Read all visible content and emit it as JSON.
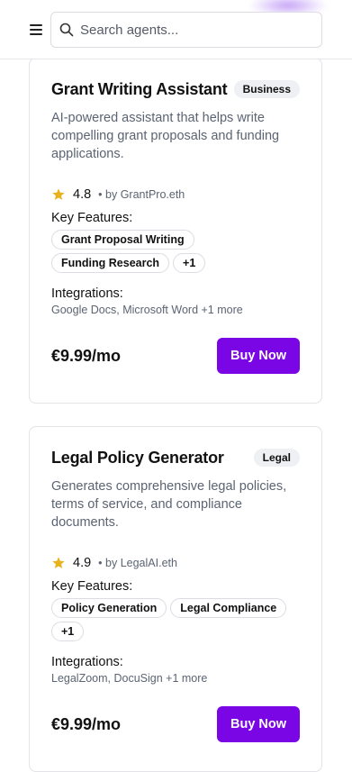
{
  "header": {
    "search_placeholder": "Search agents..."
  },
  "colors": {
    "accent": "#7a06e6",
    "star": "#e8b21c"
  },
  "cards": [
    {
      "title": "Grant Writing Assistant",
      "category": "Business",
      "description": "AI-powered assistant that helps write compelling grant proposals and funding applications.",
      "rating": "4.8",
      "byline": "• by GrantPro.eth",
      "features_label": "Key Features:",
      "features": [
        "Grant Proposal Writing",
        "Funding Research",
        "+1"
      ],
      "integrations_label": "Integrations:",
      "integrations": "Google Docs, Microsoft Word +1 more",
      "price": "€9.99/mo",
      "buy_label": "Buy Now"
    },
    {
      "title": "Legal Policy Generator",
      "category": "Legal",
      "description": "Generates comprehensive legal policies, terms of service, and compliance documents.",
      "rating": "4.9",
      "byline": "• by LegalAI.eth",
      "features_label": "Key Features:",
      "features": [
        "Policy Generation",
        "Legal Compliance",
        "+1"
      ],
      "integrations_label": "Integrations:",
      "integrations": "LegalZoom, DocuSign +1 more",
      "price": "€9.99/mo",
      "buy_label": "Buy Now"
    }
  ]
}
